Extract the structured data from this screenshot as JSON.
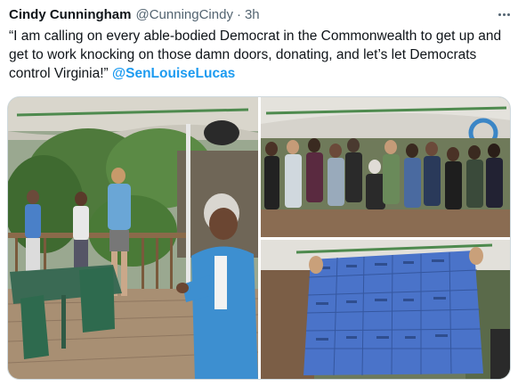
{
  "tweet": {
    "author_name": "Cindy Cunningham",
    "handle": "@CunningCindy",
    "separator": "·",
    "time": "3h",
    "text_before_mention": "“I am calling on every able-bodied Democrat in the Commonwealth to get up and get to work knocking on those damn doors, donating, and let’s let Democrats control Virginia!” ",
    "mention": "@SenLouiseLucas",
    "more_icon": "more-horizontal-icon"
  },
  "media": {
    "photos": [
      {
        "alt": "",
        "scene": "deck-gathering"
      },
      {
        "alt": "",
        "scene": "crowd-under-tent"
      },
      {
        "alt": "",
        "scene": "blue-banner-with-signatures"
      }
    ]
  },
  "colors": {
    "text": "#0f1419",
    "secondary": "#536471",
    "link": "#1d9bf0",
    "border": "#cfd9de"
  }
}
